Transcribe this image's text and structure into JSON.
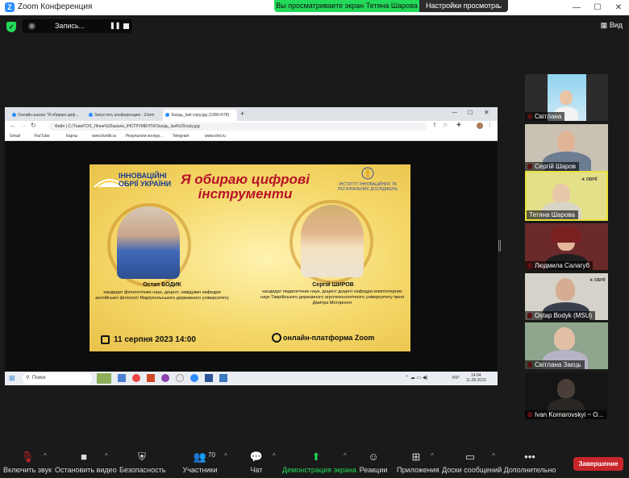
{
  "window": {
    "title": "Zoom Конференция",
    "share_banner": "Вы просматриваете экран Тетяна Шарова",
    "view_settings": "Настройки просмотра",
    "controls": [
      "—",
      "☐",
      "✕"
    ]
  },
  "topbar": {
    "recording_label": "Запись...",
    "pause_glyph": "❚❚",
    "view_label": "Вид"
  },
  "shared_screen": {
    "tabs": [
      "Онлайн-школа \"Я обираю циф...",
      "Запустить конференцию - Zoom",
      "Засідь_last copy.jpg (1000×578)"
    ],
    "tab_close": "×",
    "tab_add": "+",
    "url": "Файл | C:/Tани/ГО/1_Ліпне%20школа_ІНСТРУМЕНТИ/Засідь_last%20copy.jpg",
    "bookmarks": [
      "Gmail",
      "YouTube",
      "Карты",
      "www.livelib.ru",
      "Результати конкур...",
      "Telegram",
      "www.etxt.ru"
    ],
    "poster": {
      "brand_line1": "ІННОВАЦІЙНІ",
      "brand_line2": "ОБРІЇ УКРАЇНИ",
      "title": "Я обираю цифрові інструменти",
      "institute": "ІНСТИТУТ ІННОВАЦІЙНИХ ТА РЕГІОНАЛЬНИХ ДОСЛІДЖЕНЬ",
      "speaker1_name": "Остап БОДИК",
      "speaker1_bio": "кандидат філологічних наук, доцент, завідувач кафедри англійської філології Маріупольського державного університету",
      "speaker2_name": "Сергій ШИРОВ",
      "speaker2_bio": "кандидат педагогічних наук, доцент доцент кафедри комп'ютерних наук Таврійського державного агротехнологічного університету імені Дмитра Моторного",
      "date": "11 серпня 2023 14:00",
      "platform": "онлайн-платформа Zoom"
    },
    "taskbar": {
      "search": "Поиск",
      "lang": "УКР",
      "time": "14:04",
      "date": "11.08.2023"
    }
  },
  "participants": [
    {
      "name": "Світлана",
      "muted": true
    },
    {
      "name": "Сергій Шаров",
      "muted": true
    },
    {
      "name": "Тетяна Шарова",
      "muted": false,
      "speaking": true
    },
    {
      "name": "Людмила Салагуб",
      "muted": true
    },
    {
      "name": "Ostap Bodyk (MSU)",
      "muted": true
    },
    {
      "name": "Світлана Заєць",
      "muted": true
    },
    {
      "name": "Ivan Komarovskyi ~ О...",
      "muted": true
    }
  ],
  "toolbar": {
    "unmute": "Включить звук",
    "video": "Остановить видео",
    "security": "Безопасность",
    "participants": "Участники",
    "participants_count": "70",
    "chat": "Чат",
    "share": "Демонстрация экрана",
    "reactions": "Реакции",
    "apps": "Приложения",
    "whiteboards": "Доски сообщений",
    "more": "Дополнительно",
    "end": "Завершение"
  },
  "colors": {
    "accent_green": "#23d959",
    "end_red": "#c8262b",
    "speaker_highlight": "#e8e23a",
    "poster_title": "#b8122a"
  }
}
